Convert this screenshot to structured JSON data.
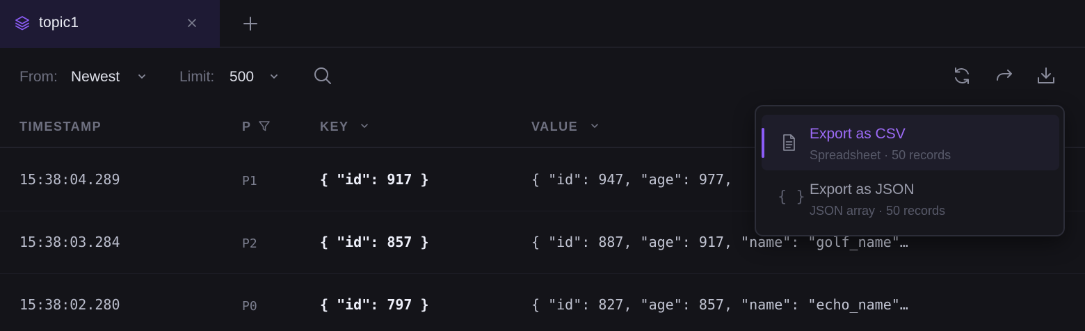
{
  "tab": {
    "label": "topic1"
  },
  "toolbar": {
    "from_label": "From:",
    "from_value": "Newest",
    "limit_label": "Limit:",
    "limit_value": "500"
  },
  "columns": {
    "timestamp": "TIMESTAMP",
    "partition": "P",
    "key": "KEY",
    "value": "VALUE"
  },
  "rows": [
    {
      "timestamp": "15:38:04.289",
      "partition": "P1",
      "key": "{ \"id\": 917 }",
      "value": "{ \"id\": 947, \"age\": 977,"
    },
    {
      "timestamp": "15:38:03.284",
      "partition": "P2",
      "key": "{ \"id\": 857 }",
      "value": "{ \"id\": 887, \"age\": 917, \"name\": \"golf_name\"…"
    },
    {
      "timestamp": "15:38:02.280",
      "partition": "P0",
      "key": "{ \"id\": 797 }",
      "value": "{ \"id\": 827, \"age\": 857, \"name\": \"echo_name\"…"
    }
  ],
  "export_menu": {
    "items": [
      {
        "title": "Export as CSV",
        "subtitle": "Spreadsheet · 50 records",
        "icon": "file-text-icon"
      },
      {
        "title": "Export as JSON",
        "subtitle": "JSON array · 50 records",
        "icon": "json-braces-icon",
        "glyph": "{ }"
      }
    ]
  },
  "colors": {
    "accent": "#8b5cf6",
    "background": "#141419",
    "active_tab": "#1e1a34"
  }
}
